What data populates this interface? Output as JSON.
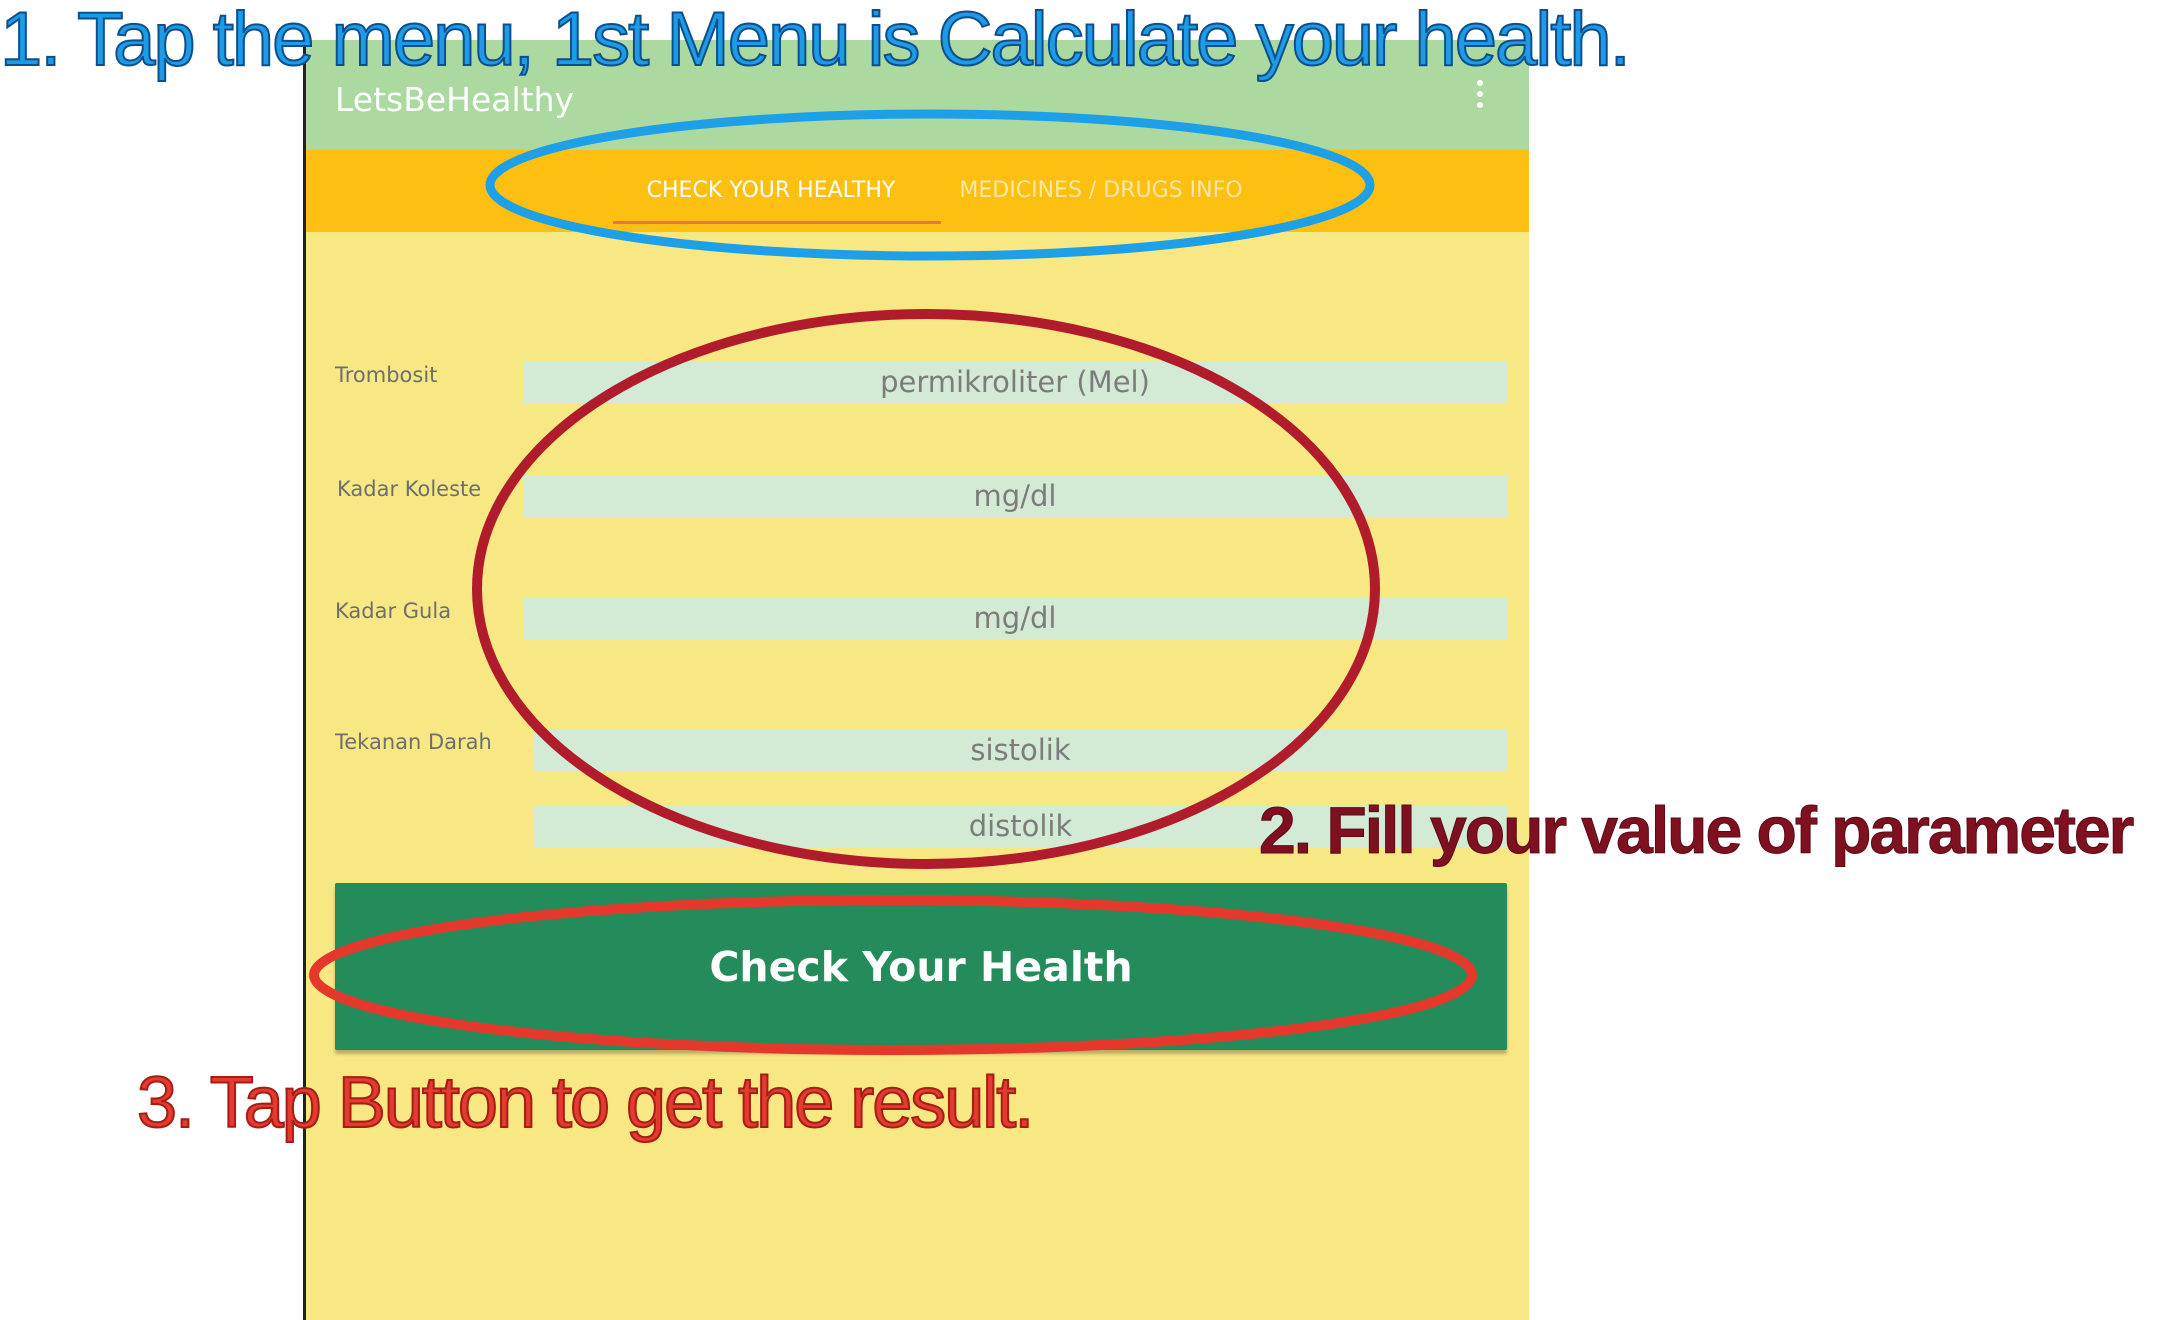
{
  "app": {
    "title": "LetsBeHealthy",
    "tabs": [
      "CHECK YOUR HEALTHY",
      "MEDICINES / DRUGS INFO"
    ],
    "active_tab": "CHECK YOUR HEALTHY",
    "colors": {
      "app_bar": "#acd9a0",
      "tab_bar": "#fdc012",
      "background": "#f8e884",
      "field": "#d3ead5",
      "button": "#248b5a"
    }
  },
  "form": {
    "trombosit": {
      "label": "Trombosit",
      "placeholder": "permikroliter (Mel)"
    },
    "kolesterol": {
      "label": "Kadar Koleste",
      "placeholder": "mg/dl"
    },
    "gula": {
      "label": "Kadar Gula",
      "placeholder": "mg/dl"
    },
    "tekanan": {
      "label": "Tekanan Darah",
      "placeholder_sistolik": "sistolik",
      "placeholder_distolik": "distolik"
    },
    "submit_label": "Check Your Health"
  },
  "annotations": {
    "step1": "1. Tap the menu, 1st Menu is Calculate your health.",
    "step2": "2. Fill your value of parameter",
    "step3": "3. Tap Button to get the result.",
    "colors": {
      "step1": "#1d9be6",
      "step2": "#7e1020",
      "step3": "#e43a2f"
    }
  }
}
